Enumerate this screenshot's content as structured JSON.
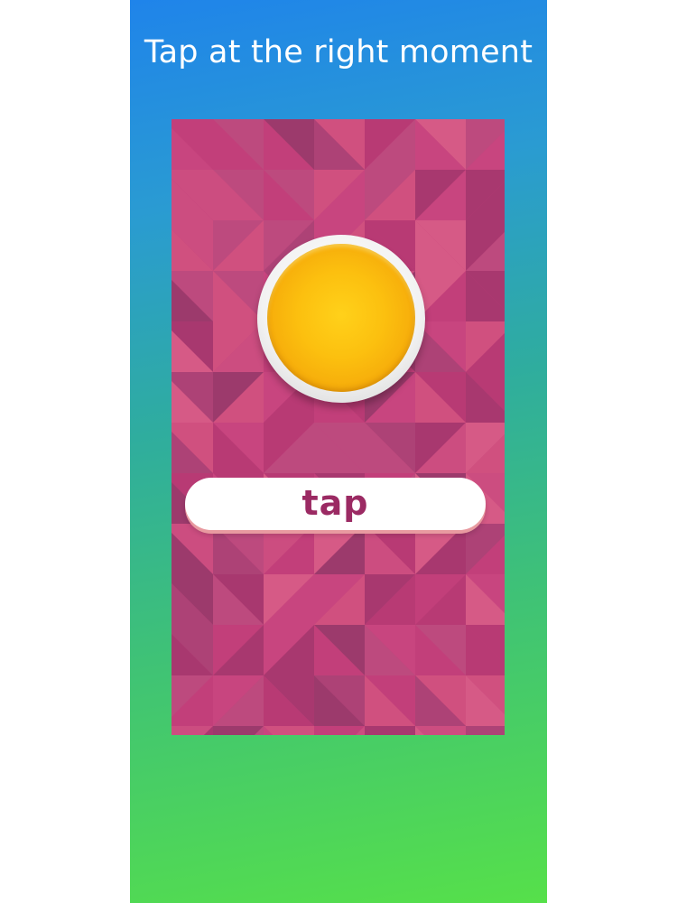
{
  "screen": {
    "headline": "Tap at the right moment"
  },
  "game": {
    "coin_color": "#fcc00f",
    "tap_button_label": "tap",
    "accent_text_color": "#9b2a63",
    "pattern_base_color": "#c23f7a"
  }
}
